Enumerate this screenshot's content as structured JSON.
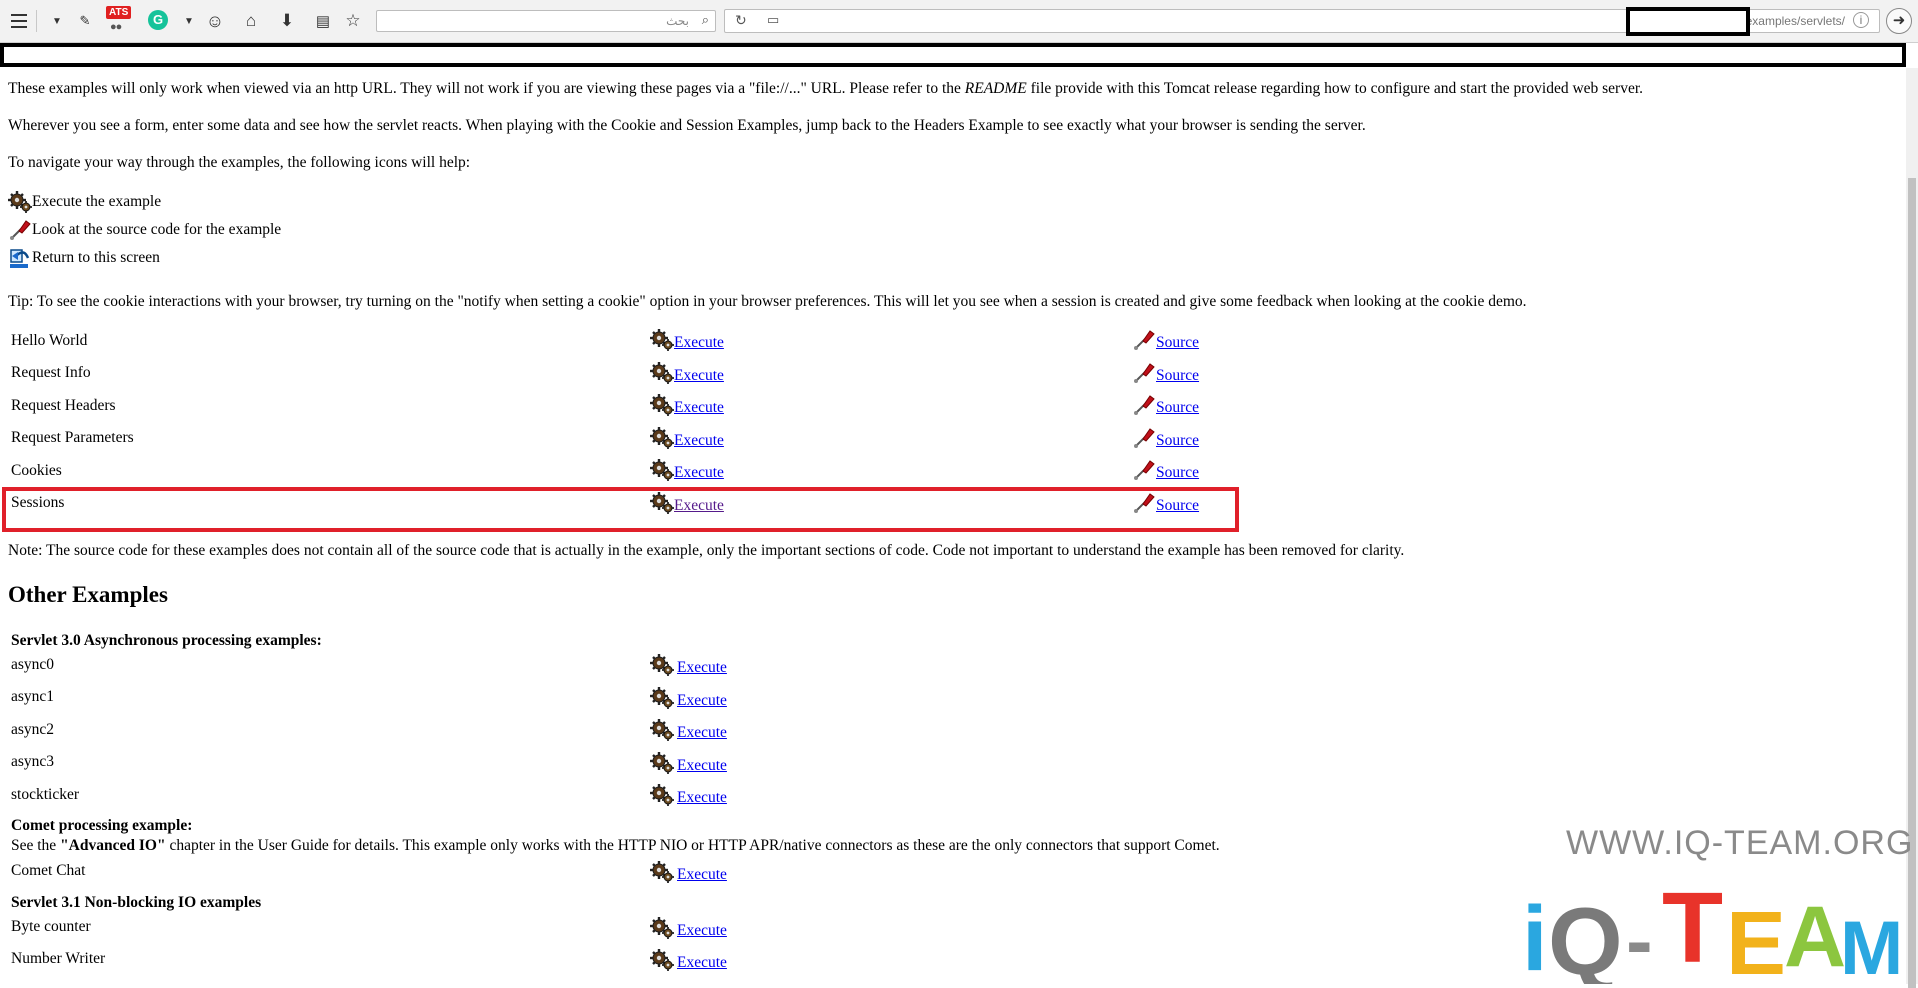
{
  "toolbar": {
    "search_placeholder": "بحث",
    "url_text": "examples/servlets/",
    "ats_badge": "ATS",
    "grammarly_letter": "G"
  },
  "intro": {
    "p1_before": "These examples will only work when viewed via an http URL. They will not work if you are viewing these pages via a \"file://...\" URL. Please refer to the ",
    "p1_readme": "README",
    "p1_after": " file provide with this Tomcat release regarding how to configure and start the provided web server.",
    "p2": "Wherever you see a form, enter some data and see how the servlet reacts. When playing with the Cookie and Session Examples, jump back to the Headers Example to see exactly what your browser is sending the server.",
    "p3": "To navigate your way through the examples, the following icons will help:"
  },
  "legend": [
    {
      "icon": "execute-icon",
      "label": "Execute the example"
    },
    {
      "icon": "source-icon",
      "label": "Look at the source code for the example"
    },
    {
      "icon": "return-icon",
      "label": "Return to this screen"
    }
  ],
  "tip": "Tip: To see the cookie interactions with your browser, try turning on the \"notify when setting a cookie\" option in your browser preferences. This will let you see when a session is created and give some feedback when looking at the cookie demo.",
  "examples": [
    {
      "name": "Hello World",
      "execute": "Execute",
      "source": "Source"
    },
    {
      "name": "Request Info",
      "execute": "Execute",
      "source": "Source"
    },
    {
      "name": "Request Headers",
      "execute": "Execute",
      "source": "Source"
    },
    {
      "name": "Request Parameters",
      "execute": "Execute",
      "source": "Source"
    },
    {
      "name": "Cookies",
      "execute": "Execute",
      "source": "Source"
    },
    {
      "name": "Sessions",
      "execute": "Execute",
      "source": "Source"
    }
  ],
  "note": "Note: The source code for these examples does not contain all of the source code that is actually in the example, only the important sections of code. Code not important to understand the example has been removed for clarity.",
  "other": {
    "heading": "Other Examples",
    "async_heading": "Servlet 3.0 Asynchronous processing examples:",
    "async_items": [
      {
        "name": "async0",
        "execute": "Execute"
      },
      {
        "name": "async1",
        "execute": "Execute"
      },
      {
        "name": "async2",
        "execute": "Execute"
      },
      {
        "name": "async3",
        "execute": "Execute"
      },
      {
        "name": "stockticker",
        "execute": "Execute"
      }
    ],
    "comet_heading": "Comet processing example:",
    "comet_desc_before": "See the ",
    "comet_desc_bold": "\"Advanced IO\"",
    "comet_desc_after": " chapter in the User Guide for details. This example only works with the HTTP NIO or HTTP APR/native connectors as these are the only connectors that support Comet.",
    "comet_item": {
      "name": "Comet Chat",
      "execute": "Execute"
    },
    "nio_heading": "Servlet 3.1 Non-blocking IO examples",
    "nio_items": [
      {
        "name": "Byte counter",
        "execute": "Execute"
      },
      {
        "name": "Number Writer",
        "execute": "Execute"
      }
    ]
  },
  "watermark": {
    "url": "WWW.IQ-TEAM.ORG",
    "logo_text": "iQ-TEAM"
  }
}
